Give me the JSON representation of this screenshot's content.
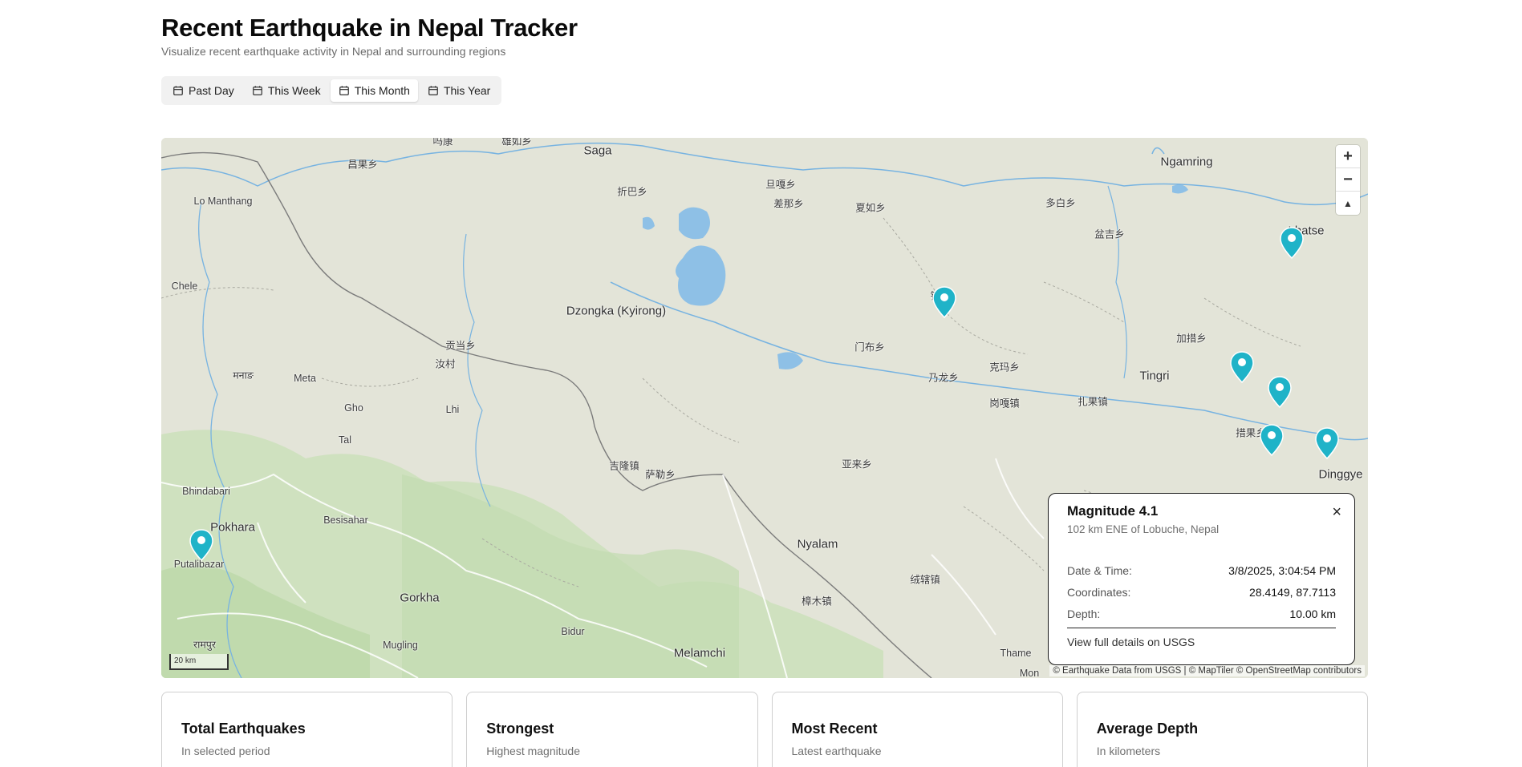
{
  "header": {
    "title": "Recent Earthquake in Nepal Tracker",
    "subtitle": "Visualize recent earthquake activity in Nepal and surrounding regions"
  },
  "tabs": [
    {
      "label": "Past Day",
      "active": false
    },
    {
      "label": "This Week",
      "active": false
    },
    {
      "label": "This Month",
      "active": true
    },
    {
      "label": "This Year",
      "active": false
    }
  ],
  "map": {
    "places": [
      "吗康",
      "雄如乡",
      "Saga",
      "Ngamring",
      "昌果乡",
      "旦嘎乡",
      "折巴乡",
      "差那乡",
      "夏如乡",
      "多白乡",
      "Lo Manthang",
      "盆吉乡",
      "Lhatse",
      "Chele",
      "镇乡",
      "Dzongka (Kyirong)",
      "贡当乡",
      "门布乡",
      "加措乡",
      "汝村",
      "克玛乡",
      "乃龙乡",
      "Tingri",
      "मनाङ",
      "Meta",
      "岗嘎镇",
      "扎果镇",
      "Gho",
      "Lhi",
      "措果乡",
      "Tal",
      "亚来乡",
      "吉隆镇",
      "萨勒乡",
      "Dinggye",
      "Bhindabari",
      "Pokhara",
      "Besisahar",
      "Putalibazar",
      "Nyalam",
      "绒辖镇",
      "Gorkha",
      "樟木镇",
      "Bidur",
      "रामपुर",
      "Mugling",
      "Melamchi",
      "Thame",
      "Mon"
    ],
    "zoom_in": "+",
    "zoom_out": "−",
    "compass": "▲",
    "scale_label": "20 km",
    "attribution": "© Earthquake Data from USGS | © MapTiler © OpenStreetMap contributors",
    "marker_color": "#1fb3c8"
  },
  "popup": {
    "title": "Magnitude 4.1",
    "location": "102 km ENE of Lobuche, Nepal",
    "close": "×",
    "rows": [
      {
        "label": "Date & Time:",
        "value": "3/8/2025, 3:04:54 PM"
      },
      {
        "label": "Coordinates:",
        "value": "28.4149, 87.7113"
      },
      {
        "label": "Depth:",
        "value": "10.00 km"
      }
    ],
    "link": "View full details on USGS"
  },
  "cards": [
    {
      "title": "Total Earthquakes",
      "subtitle": "In selected period"
    },
    {
      "title": "Strongest",
      "subtitle": "Highest magnitude"
    },
    {
      "title": "Most Recent",
      "subtitle": "Latest earthquake"
    },
    {
      "title": "Average Depth",
      "subtitle": "In kilometers"
    }
  ]
}
